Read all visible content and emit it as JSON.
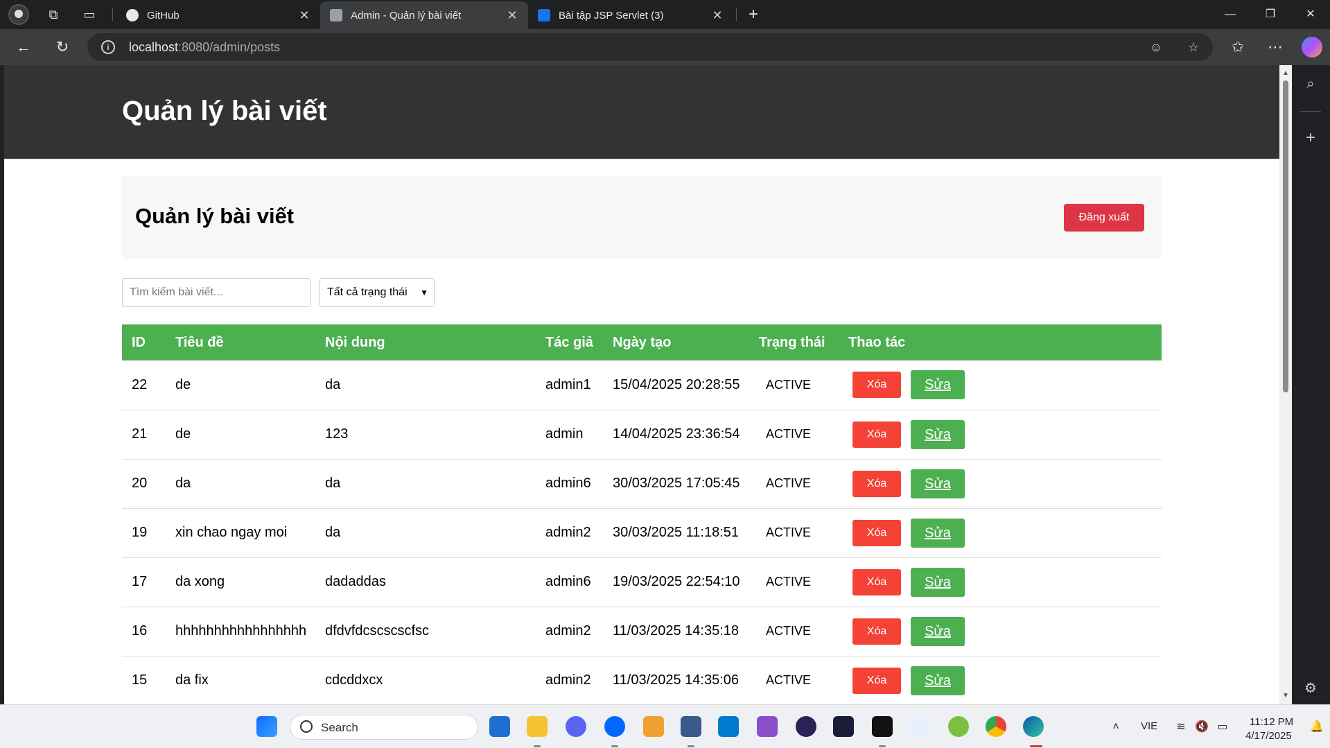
{
  "browser": {
    "tabs": [
      {
        "label": "GitHub",
        "active": false
      },
      {
        "label": "Admin - Quản lý bài viết",
        "active": true
      },
      {
        "label": "Bài tập JSP Servlet (3)",
        "active": false
      }
    ],
    "address": {
      "host": "localhost",
      "path": ":8080/admin/posts"
    }
  },
  "page": {
    "header_title": "Quản lý bài viết",
    "panel_title": "Quản lý bài viết",
    "logout_label": "Đăng xuất",
    "search_placeholder": "Tìm kiếm bài viết...",
    "status_filter": "Tất cả trạng thái",
    "columns": [
      "ID",
      "Tiêu đề",
      "Nội dung",
      "Tác giả",
      "Ngày tạo",
      "Trạng thái",
      "Thao tác"
    ],
    "delete_label": "Xóa",
    "edit_label": "Sửa",
    "rows": [
      {
        "id": "22",
        "title": "de",
        "content": "da",
        "author": "admin1",
        "created": "15/04/2025 20:28:55",
        "status": "ACTIVE"
      },
      {
        "id": "21",
        "title": "de",
        "content": "123",
        "author": "admin",
        "created": "14/04/2025 23:36:54",
        "status": "ACTIVE"
      },
      {
        "id": "20",
        "title": "da",
        "content": "da",
        "author": "admin6",
        "created": "30/03/2025 17:05:45",
        "status": "ACTIVE"
      },
      {
        "id": "19",
        "title": "xin chao ngay moi",
        "content": "da",
        "author": "admin2",
        "created": "30/03/2025 11:18:51",
        "status": "ACTIVE"
      },
      {
        "id": "17",
        "title": "da xong",
        "content": "dadaddas",
        "author": "admin6",
        "created": "19/03/2025 22:54:10",
        "status": "ACTIVE"
      },
      {
        "id": "16",
        "title": "hhhhhhhhhhhhhhhhh",
        "content": "dfdvfdcscscscfsc",
        "author": "admin2",
        "created": "11/03/2025 14:35:18",
        "status": "ACTIVE"
      },
      {
        "id": "15",
        "title": "da fix",
        "content": "cdcddxcx",
        "author": "admin2",
        "created": "11/03/2025 14:35:06",
        "status": "ACTIVE"
      }
    ]
  },
  "taskbar": {
    "search_label": "Search",
    "language": "VIE",
    "time": "11:12 PM",
    "date": "4/17/2025"
  },
  "colors": {
    "header_bg": "#333333",
    "table_header": "#4caf50",
    "delete_button": "#f44336",
    "logout_button": "#dc3545"
  }
}
